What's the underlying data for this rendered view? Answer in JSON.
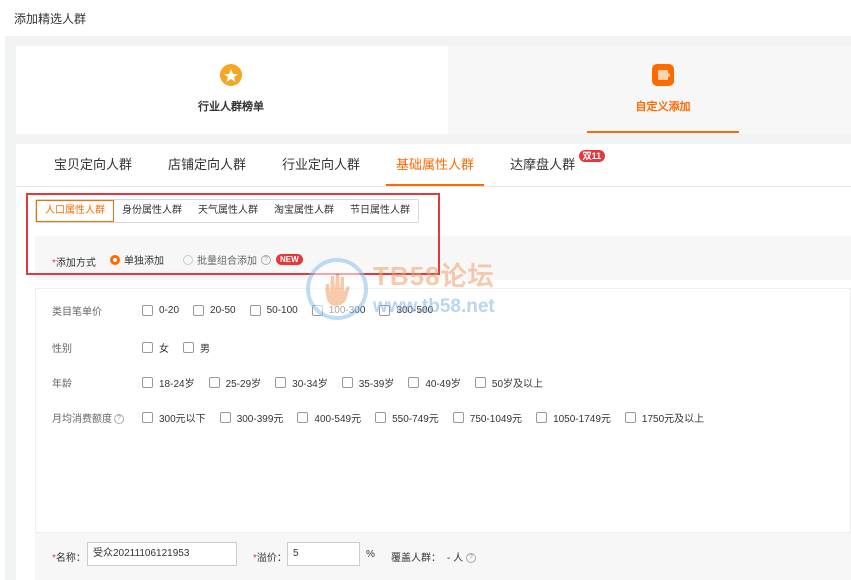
{
  "page_title": "添加精选人群",
  "entries": [
    {
      "label": "行业人群榜单",
      "icon": "medal-icon"
    },
    {
      "label": "自定义添加",
      "icon": "puzzle-icon"
    }
  ],
  "tabs": [
    {
      "label": "宝贝定向人群"
    },
    {
      "label": "店铺定向人群"
    },
    {
      "label": "行业定向人群"
    },
    {
      "label": "基础属性人群"
    },
    {
      "label": "达摩盘人群",
      "badge": "双11"
    }
  ],
  "subtabs": [
    "人口属性人群",
    "身份属性人群",
    "天气属性人群",
    "淘宝属性人群",
    "节日属性人群"
  ],
  "method": {
    "required_mark": "*",
    "label": "添加方式",
    "options": [
      "单独添加",
      "批量组合添加"
    ],
    "new_badge": "NEW",
    "help": "?"
  },
  "attributes": [
    {
      "label": "类目笔单价",
      "options": [
        "0-20",
        "20-50",
        "50-100",
        "100-300",
        "300-500"
      ]
    },
    {
      "label": "性别",
      "options": [
        "女",
        "男"
      ]
    },
    {
      "label": "年龄",
      "options": [
        "18-24岁",
        "25-29岁",
        "30-34岁",
        "35-39岁",
        "40-49岁",
        "50岁及以上"
      ]
    },
    {
      "label": "月均消费额度",
      "options": [
        "300元以下",
        "300-399元",
        "400-549元",
        "550-749元",
        "750-1049元",
        "1050-1749元",
        "1750元及以上"
      ]
    }
  ],
  "help_mark": "?",
  "bottom": {
    "name_label": "名称：",
    "name_value": "受众20211106121953",
    "premium_label": "溢价：",
    "premium_value": "5",
    "percent": "%",
    "coverage_label": "覆盖人群：",
    "coverage_value": "- 人"
  },
  "watermark": {
    "line1": "TB58论坛",
    "line2": "www.tb58.net"
  },
  "colors": {
    "accent": "#ff6a00",
    "highlight": "#e4393c"
  }
}
